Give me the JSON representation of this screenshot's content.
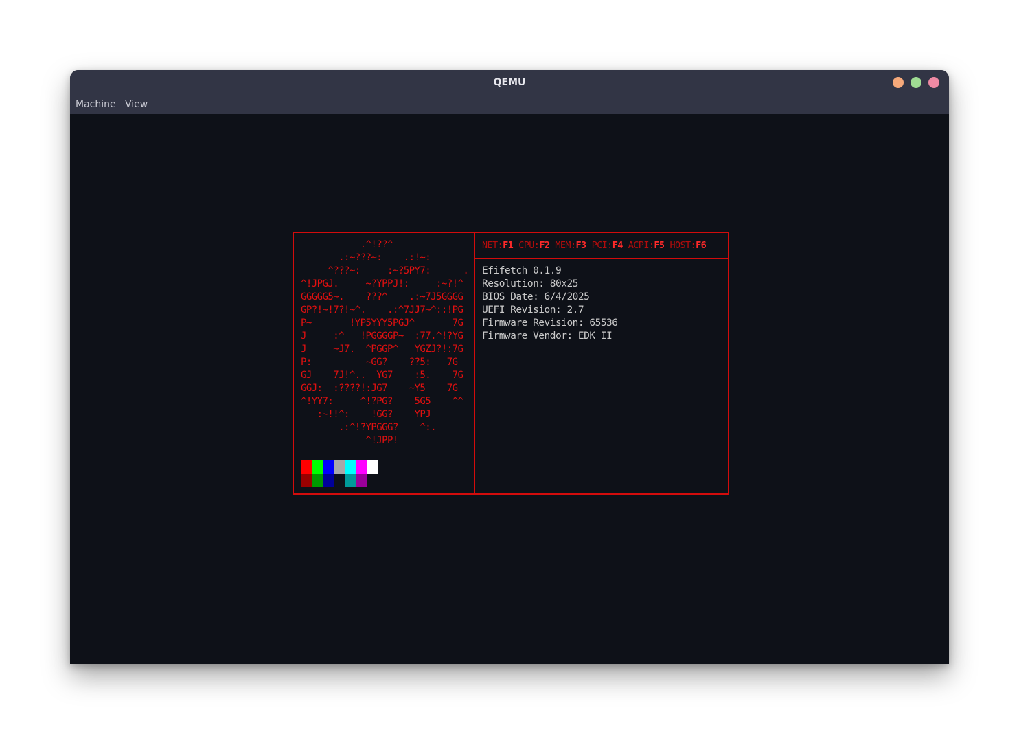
{
  "window": {
    "title": "QEMU",
    "controls": [
      "minimize",
      "maximize",
      "close"
    ]
  },
  "menu": {
    "machine": "Machine",
    "view": "View"
  },
  "logo_lines": [
    "           .^!??^",
    "       .:~???~:    .:!~:",
    "     ^???~:     :~?5PY7:      .",
    "^!JPGJ.     ~?YPPJ!:     :~?!^",
    "GGGGG5~.    ???^    .:~7J5GGGG",
    "GP?!~!7?!~^.    .:^7JJ7~^::!PG",
    "P~       !YP5YYY5PGJ^       7G",
    "J     :^   !PGGGGP~  :77.^!?YG",
    "J     ~J7.  ^PGGP^   YGZJ?!:7G",
    "P:          ~GG?    ??5:   7G",
    "GJ    7J!^..  YG7    :5.    7G",
    "GGJ:  :????!:JG7    ~Y5    7G",
    "^!YY7:     ^!?PG?    5G5    ^^",
    "   :~!!^:    !GG?    YPJ",
    "       .:^!?YPGGG?    ^:.",
    "            ^!JPP!"
  ],
  "palette": {
    "bright": [
      "#ff0000",
      "#00ff00",
      "#0000ff",
      "#a8a8a8",
      "#00ffff",
      "#ff00ff",
      "#ffffff"
    ],
    "dark": [
      "#9a0000",
      "#009a00",
      "#00009a",
      "#0e1118",
      "#009a9a",
      "#9a009a",
      "#0e1118"
    ]
  },
  "function_keys": [
    {
      "label": "NET",
      "sep": ":",
      "key": "F1"
    },
    {
      "label": "CPU",
      "sep": ":",
      "key": "F2"
    },
    {
      "label": "MEM",
      "sep": ":",
      "key": "F3"
    },
    {
      "label": "PCI",
      "sep": ":",
      "key": "F4"
    },
    {
      "label": "ACPI",
      "sep": ":",
      "key": "F5"
    },
    {
      "label": "HOST",
      "sep": ":",
      "key": "F6"
    }
  ],
  "info_lines": [
    "Efifetch 0.1.9",
    "Resolution: 80x25",
    "BIOS Date: 6/4/2025",
    "UEFI Revision: 2.7",
    "Firmware Revision: 65536",
    "Firmware Vendor: EDK II"
  ]
}
